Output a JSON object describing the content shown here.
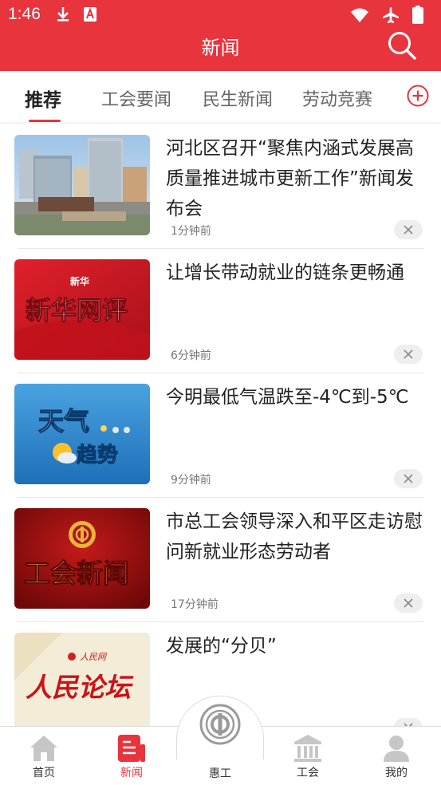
{
  "status_bar": {
    "time": "1:46"
  },
  "header": {
    "title": "新闻"
  },
  "tabs": [
    {
      "label": "推荐"
    },
    {
      "label": "工会要闻"
    },
    {
      "label": "民生新闻"
    },
    {
      "label": "劳动竞赛"
    }
  ],
  "news": [
    {
      "title": "河北区召开“聚焦内涵式发展高质量推进城市更新工作”新闻发布会",
      "time": "1分钟前",
      "thumb_icon": "city-buildings-photo"
    },
    {
      "title": "让增长带动就业的链条更畅通",
      "time": "6分钟前",
      "thumb_icon": "xinhua-commentary-banner",
      "thumb_text": "新华网评",
      "thumb_logo": "新华"
    },
    {
      "title": "今明最低气温跌至-4℃到-5℃",
      "time": "9分钟前",
      "thumb_icon": "weather-trend-banner",
      "thumb_text_1": "天气",
      "thumb_text_2": "趋势"
    },
    {
      "title": "市总工会领导深入和平区走访慰问新就业形态劳动者",
      "time": "17分钟前",
      "thumb_icon": "union-news-banner",
      "thumb_text": "工会新闻"
    },
    {
      "title": "发展的“分贝”",
      "time": "",
      "thumb_icon": "people-forum-banner",
      "thumb_text": "人民论坛",
      "thumb_logo": "人民网"
    }
  ],
  "bottom_nav": [
    {
      "label": "首页",
      "icon": "home-icon"
    },
    {
      "label": "新闻",
      "icon": "news-icon"
    },
    {
      "label": "惠工",
      "icon": "union-emblem-icon"
    },
    {
      "label": "工会",
      "icon": "bank-icon"
    },
    {
      "label": "我的",
      "icon": "user-icon"
    }
  ],
  "colors": {
    "brand": "#e8343d",
    "active_tab_indicator": "#e8343d"
  }
}
